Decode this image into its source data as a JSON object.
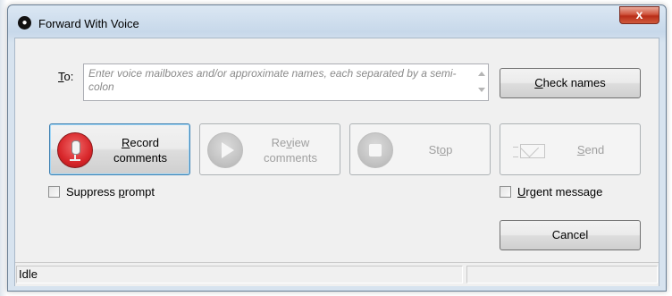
{
  "window": {
    "title": "Forward With Voice",
    "app_icon": "voicemail-logo-icon",
    "close_label": "x"
  },
  "to": {
    "label_accel": "T",
    "label_rest": "o:",
    "placeholder": "Enter voice mailboxes and/or approximate names, each separated by a semi-colon",
    "value": ""
  },
  "buttons": {
    "check_names": {
      "accel": "C",
      "rest": "heck names"
    },
    "record": {
      "line1_accel": "R",
      "line1_rest": "ecord",
      "line2": "comments",
      "icon": "microphone-icon"
    },
    "review": {
      "line1_pre": "Re",
      "line1_accel": "v",
      "line1_rest": "iew",
      "line2": "comments",
      "icon": "play-icon"
    },
    "stop": {
      "pre": "St",
      "accel": "o",
      "rest": "p",
      "icon": "stop-icon"
    },
    "send": {
      "accel": "S",
      "rest": "end",
      "icon": "envelope-icon"
    },
    "cancel": {
      "label": "Cancel"
    }
  },
  "options": {
    "suppress_prompt": {
      "pre": "Suppress ",
      "accel": "p",
      "rest": "rompt",
      "checked": false
    },
    "urgent_message": {
      "accel": "U",
      "rest": "rgent message",
      "checked": false
    }
  },
  "status": {
    "pane1": "Idle",
    "pane2": ""
  },
  "colors": {
    "record_icon": "#d8262a",
    "disabled_text": "#a0a0a0",
    "focus_border": "#3c7fb1"
  }
}
